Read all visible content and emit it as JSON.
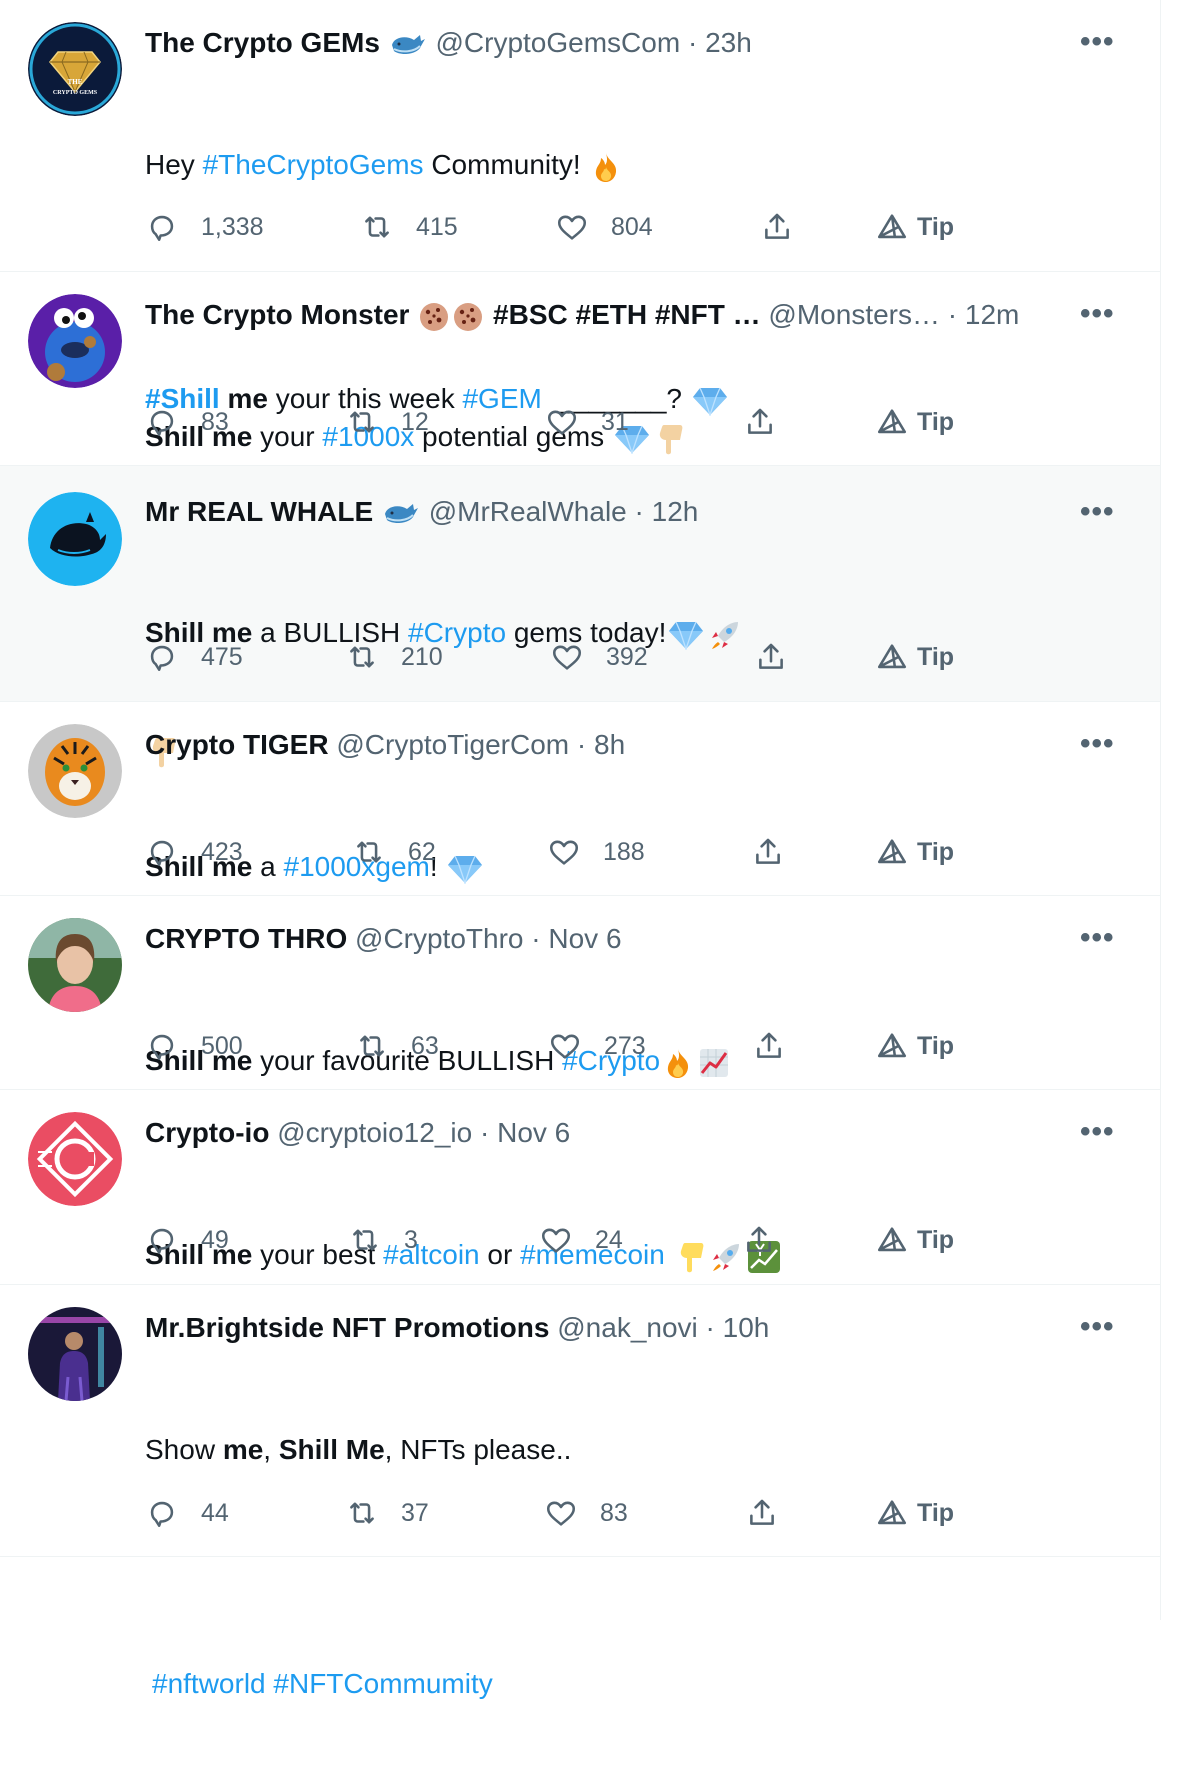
{
  "colors": {
    "accent": "#1d9bf0",
    "text": "#0f1419",
    "muted": "#536471",
    "highlight": "#f7f9f9"
  },
  "actions": {
    "tip_label": "Tip"
  },
  "more_label": "•••",
  "tweets": [
    {
      "name": "The Crypto GEMs",
      "verified_emoji": "whale",
      "handle": "@CryptoGemsCom",
      "sep": "·",
      "time": "23h",
      "avatar_text_1": "THE",
      "avatar_text_2": "CRYPTO GEMS",
      "line1": {
        "a": "Hey ",
        "t1": "#TheCryptoGems",
        "b": " Community! "
      },
      "line2": {
        "t1": "#Shill",
        "b1": " me",
        "c": " your this week ",
        "t2": "#GEM",
        "d": "  _______? "
      },
      "replies": "1,338",
      "retweets": "415",
      "likes": "804"
    },
    {
      "name": "The Crypto Monster",
      "name_suffix": "#BSC #ETH #NFT …",
      "handle": "@Monsters…",
      "sep": "·",
      "time": "12m",
      "line1": {
        "b1": "Shill me",
        "a": " your ",
        "t1": "#1000x",
        "b": " potential gems "
      },
      "replies": "83",
      "retweets": "12",
      "likes": "31"
    },
    {
      "name": "Mr REAL WHALE",
      "handle": "@MrRealWhale",
      "sep": "·",
      "time": "12h",
      "line1": {
        "b1": "Shill me",
        "a": " a BULLISH ",
        "t1": "#Crypto",
        "b": " gems today!"
      },
      "replies": "475",
      "retweets": "210",
      "likes": "392"
    },
    {
      "name": "Crypto TIGER",
      "handle": "@CryptoTigerCom",
      "sep": "·",
      "time": "8h",
      "line1": {
        "b1": "Shill me",
        "a": " a ",
        "t1": "#1000xgem",
        "b": "! "
      },
      "replies": "423",
      "retweets": "62",
      "likes": "188"
    },
    {
      "name": "CRYPTO THRO",
      "handle": "@CryptoThro",
      "sep": "·",
      "time": "Nov 6",
      "line1": {
        "b1": "Shill me",
        "a": " your favourite BULLISH ",
        "t1": "#Crypto"
      },
      "replies": "500",
      "retweets": "63",
      "likes": "273"
    },
    {
      "name": "Crypto-io",
      "handle": "@cryptoio12_io",
      "sep": "·",
      "time": "Nov 6",
      "line1": {
        "b1": "Shill me",
        "a": " your best ",
        "t1": "#altcoin",
        "b": " or ",
        "t2": "#memecoin",
        "c": " "
      },
      "replies": "49",
      "retweets": "3",
      "likes": "24"
    },
    {
      "name": "Mr.Brightside NFT Promotions",
      "handle": "@nak_novi",
      "sep": "·",
      "time": "10h",
      "line1": {
        "a": "Show ",
        "b1": "me",
        "b": ", ",
        "b2": "Shill Me",
        "c": ", NFTs please.."
      },
      "line2": {
        "t1": "#nftworld",
        "sp": " ",
        "t2": "#NFTCommumity"
      },
      "replies": "44",
      "retweets": "37",
      "likes": "83"
    }
  ]
}
